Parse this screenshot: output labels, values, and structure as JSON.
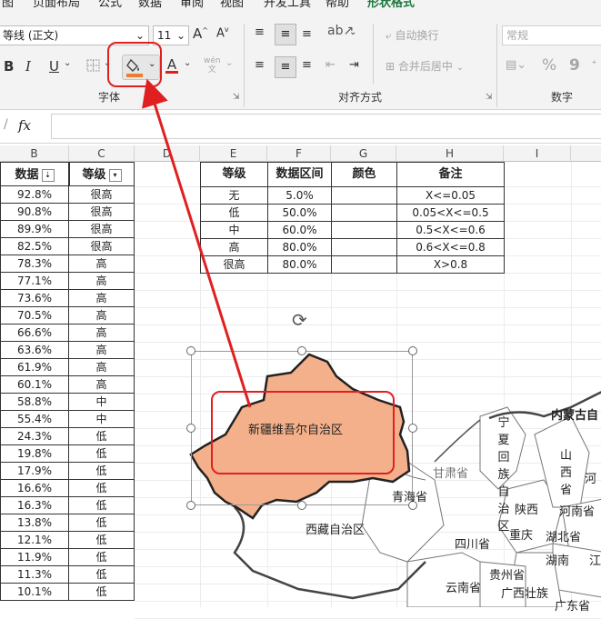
{
  "menu": {
    "items": [
      "图",
      "页面布局",
      "公式",
      "数据",
      "审阅",
      "视图",
      "开发工具",
      "帮助",
      "形状格式"
    ]
  },
  "ribbon": {
    "font_name": "等线 (正文)",
    "font_size": "11",
    "increase_font": "A",
    "decrease_font": "A",
    "bold": "B",
    "italic": "I",
    "underline": "U",
    "font_color_letter": "A",
    "phonetic": "wén",
    "group_font": "字体",
    "group_alignment": "对齐方式",
    "group_number": "数字",
    "wrap_text": "自动换行",
    "merge_center": "合并后居中",
    "number_format": "常规",
    "percent": "%",
    "comma": "9"
  },
  "formula_bar": {
    "fx": "fx",
    "value": ""
  },
  "columns": [
    "B",
    "C",
    "D",
    "E",
    "F",
    "G",
    "H",
    "I"
  ],
  "left_table": {
    "headers": [
      "数据",
      "等级"
    ],
    "rows": [
      [
        "92.8%",
        "很高"
      ],
      [
        "90.8%",
        "很高"
      ],
      [
        "89.9%",
        "很高"
      ],
      [
        "82.5%",
        "很高"
      ],
      [
        "78.3%",
        "高"
      ],
      [
        "77.1%",
        "高"
      ],
      [
        "73.6%",
        "高"
      ],
      [
        "70.5%",
        "高"
      ],
      [
        "66.6%",
        "高"
      ],
      [
        "63.6%",
        "高"
      ],
      [
        "61.9%",
        "高"
      ],
      [
        "60.1%",
        "高"
      ],
      [
        "58.8%",
        "中"
      ],
      [
        "55.4%",
        "中"
      ],
      [
        "24.3%",
        "低"
      ],
      [
        "19.8%",
        "低"
      ],
      [
        "17.9%",
        "低"
      ],
      [
        "16.6%",
        "低"
      ],
      [
        "16.3%",
        "低"
      ],
      [
        "13.8%",
        "低"
      ],
      [
        "12.1%",
        "低"
      ],
      [
        "11.9%",
        "低"
      ],
      [
        "11.3%",
        "低"
      ],
      [
        "10.1%",
        "低"
      ]
    ]
  },
  "legend_table": {
    "headers": [
      "等级",
      "数据区间",
      "颜色",
      "备注"
    ],
    "rows": [
      [
        "无",
        "5.0%",
        "",
        "X<=0.05"
      ],
      [
        "低",
        "50.0%",
        "",
        "0.05<X<=0.5"
      ],
      [
        "中",
        "60.0%",
        "",
        "0.5<X<=0.6"
      ],
      [
        "高",
        "80.0%",
        "",
        "0.6<X<=0.8"
      ],
      [
        "很高",
        "80.0%",
        "",
        "X>0.8"
      ]
    ]
  },
  "map": {
    "selected_region": "新疆维吾尔自治区",
    "selected_fill": "#f4b08a",
    "labels": {
      "tibet": "西藏自治区",
      "qinghai": "青海省",
      "gansu": "甘肃省",
      "inner_mongolia": "内蒙古自",
      "ningxia": [
        "宁",
        "夏",
        "回",
        "族",
        "自",
        "治",
        "区"
      ],
      "shaanxi": "陕西",
      "shanxi": [
        "山",
        "西",
        "省"
      ],
      "hebei": "河",
      "henan": "河南省",
      "hubei": "湖北省",
      "hunan": "湖南",
      "sichuan": "四川省",
      "guizhou": "贵州省",
      "yunnan": "云南省",
      "guangxi": "广西壮族",
      "guangdong": "广东省",
      "chongqing": "重庆",
      "jiang": "江"
    }
  },
  "colors": {
    "highlight": "#e02020",
    "arrow": "#e02020",
    "fill_orange": "#f4b08a"
  }
}
